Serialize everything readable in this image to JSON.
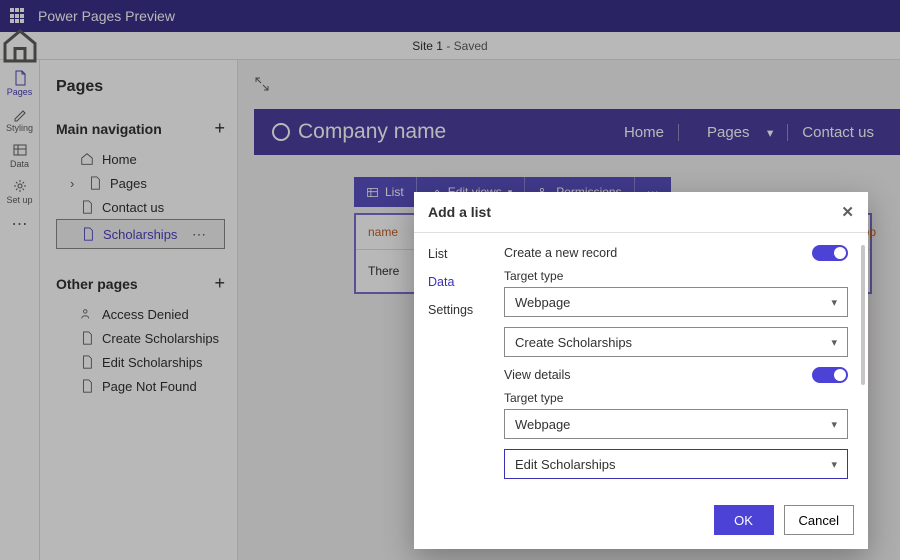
{
  "app": {
    "title": "Power Pages Preview"
  },
  "status": {
    "site": "Site 1",
    "state": "Saved"
  },
  "rail": {
    "pages": "Pages",
    "styling": "Styling",
    "data": "Data",
    "setup": "Set up"
  },
  "panel": {
    "title": "Pages",
    "main_nav": "Main navigation",
    "other_pages": "Other pages",
    "items_main": {
      "home": "Home",
      "pages": "Pages",
      "contact": "Contact us",
      "scholarships": "Scholarships"
    },
    "items_other": {
      "access_denied": "Access Denied",
      "create_sch": "Create Scholarships",
      "edit_sch": "Edit Scholarships",
      "pnf": "Page Not Found"
    }
  },
  "site_header": {
    "brand": "Company name",
    "nav": {
      "home": "Home",
      "pages": "Pages",
      "contact": "Contact us"
    }
  },
  "cmdbar": {
    "list": "List",
    "edit_views": "Edit views",
    "permissions": "Permissions"
  },
  "list_preview": {
    "col_name": "name",
    "col_app": "App",
    "empty": "There"
  },
  "modal": {
    "title": "Add a list",
    "tabs": {
      "list": "List",
      "data": "Data",
      "settings": "Settings"
    },
    "create_record": "Create a new record",
    "target_type_label": "Target type",
    "target_type_value": "Webpage",
    "create_page_value": "Create Scholarships",
    "view_details": "View details",
    "edit_page_value": "Edit Scholarships",
    "ok": "OK",
    "cancel": "Cancel"
  }
}
